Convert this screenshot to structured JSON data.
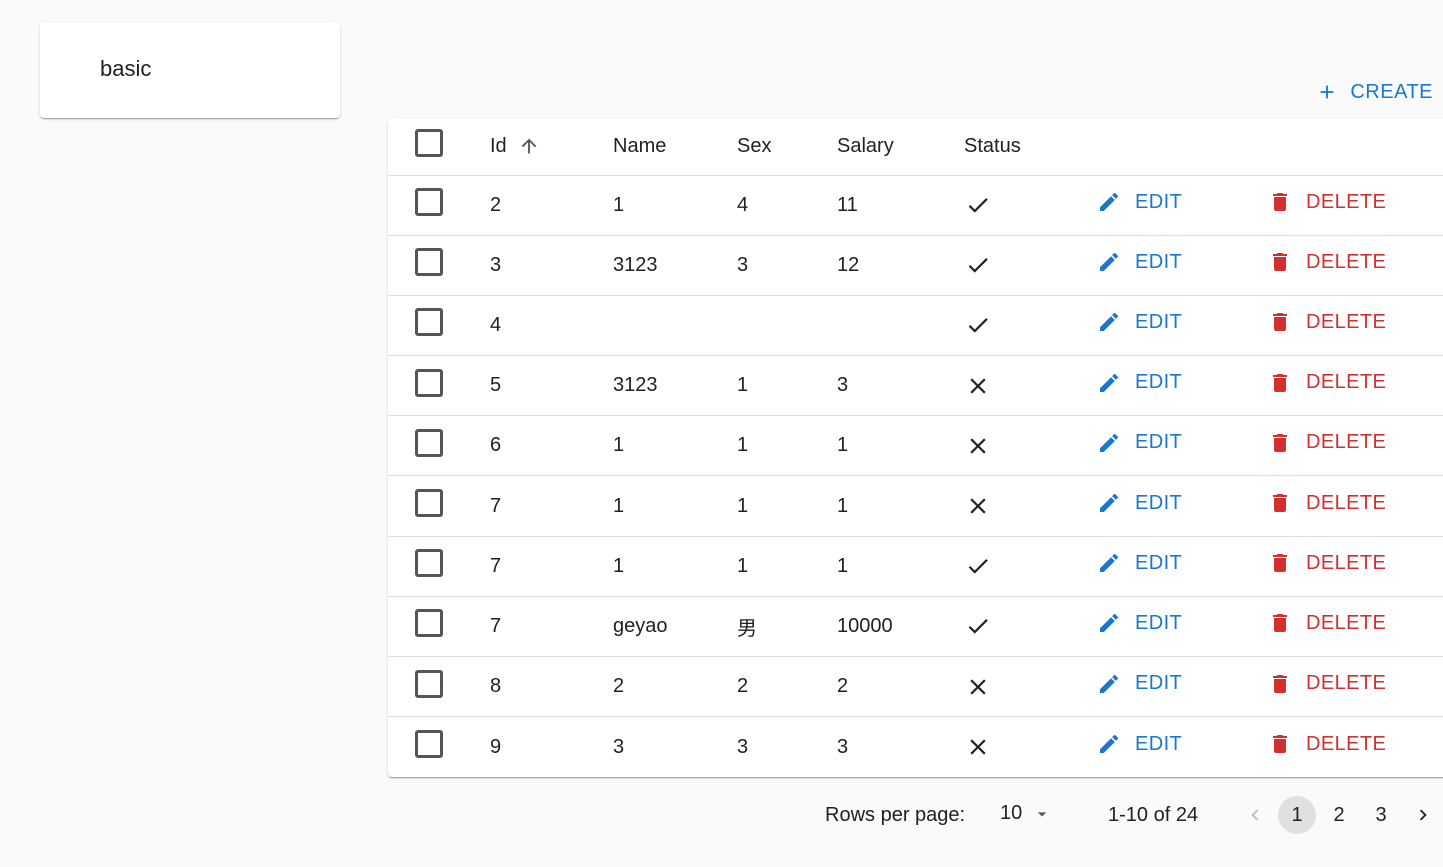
{
  "sidebar": {
    "menu_item": "basic"
  },
  "toolbar": {
    "create_label": "CREATE"
  },
  "table": {
    "columns": [
      "Id",
      "Name",
      "Sex",
      "Salary",
      "Status"
    ],
    "sort": {
      "column": "Id",
      "direction": "asc"
    },
    "edit_label": "EDIT",
    "delete_label": "DELETE",
    "rows": [
      {
        "id": "2",
        "name": "1",
        "sex": "4",
        "salary": "11",
        "status": "check"
      },
      {
        "id": "3",
        "name": "3123",
        "sex": "3",
        "salary": "12",
        "status": "check"
      },
      {
        "id": "4",
        "name": "",
        "sex": "",
        "salary": "",
        "status": "check"
      },
      {
        "id": "5",
        "name": "3123",
        "sex": "1",
        "salary": "3",
        "status": "cross"
      },
      {
        "id": "6",
        "name": "1",
        "sex": "1",
        "salary": "1",
        "status": "cross"
      },
      {
        "id": "7",
        "name": "1",
        "sex": "1",
        "salary": "1",
        "status": "cross"
      },
      {
        "id": "7",
        "name": "1",
        "sex": "1",
        "salary": "1",
        "status": "check"
      },
      {
        "id": "7",
        "name": "geyao",
        "sex": "男",
        "salary": "10000",
        "status": "check"
      },
      {
        "id": "8",
        "name": "2",
        "sex": "2",
        "salary": "2",
        "status": "cross"
      },
      {
        "id": "9",
        "name": "3",
        "sex": "3",
        "salary": "3",
        "status": "cross"
      }
    ]
  },
  "pagination": {
    "rows_per_page_label": "Rows per page:",
    "rows_per_page": "10",
    "range": "1-10 of 24",
    "pages": [
      "1",
      "2",
      "3"
    ],
    "current_page": "1"
  },
  "colors": {
    "primary": "#1976d2",
    "danger": "#d32f2f"
  }
}
